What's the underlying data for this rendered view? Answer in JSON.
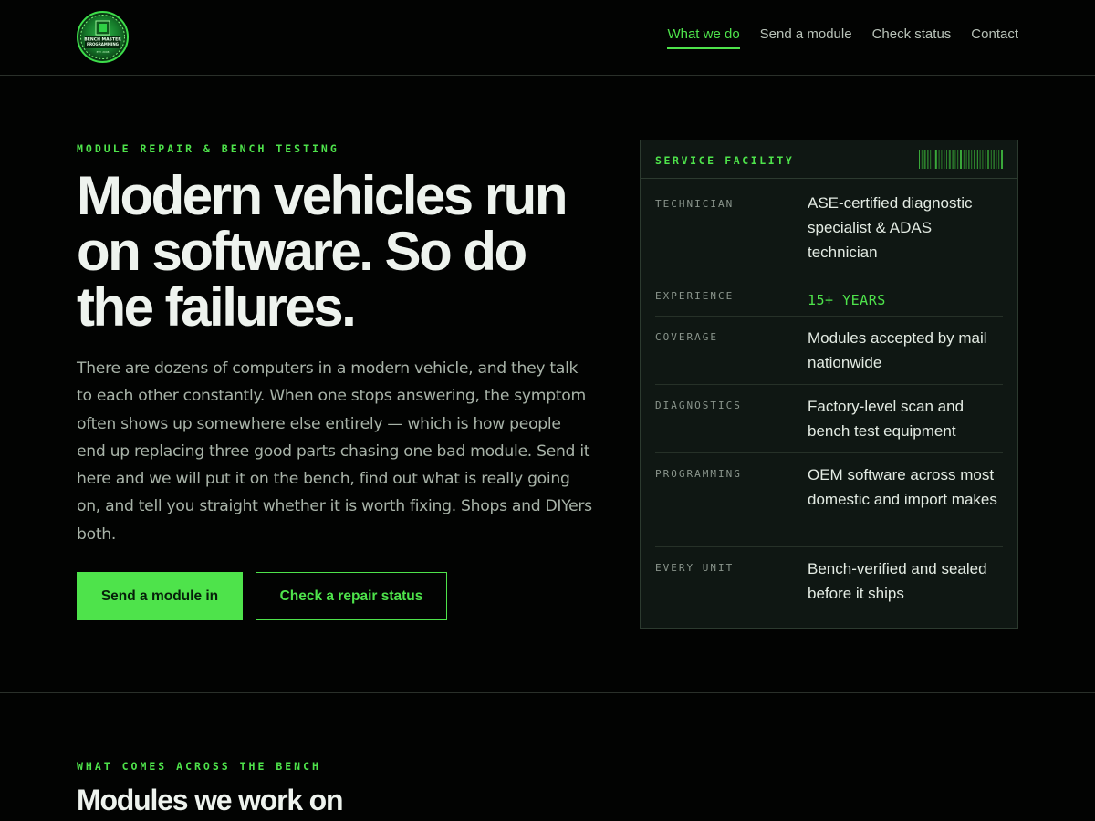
{
  "header": {
    "logo": {
      "icon": "bench-master-programming-logo",
      "text": [
        "BENCH MASTER",
        "PROGRAMMING",
        "EST. 2008"
      ]
    },
    "nav": [
      {
        "label": "What we do",
        "active": true
      },
      {
        "label": "Send a module",
        "active": false
      },
      {
        "label": "Check status",
        "active": false
      },
      {
        "label": "Contact",
        "active": false
      }
    ]
  },
  "hero": {
    "eyebrow": "MODULE REPAIR & BENCH TESTING",
    "title": "Modern vehicles run on software. So do the failures.",
    "body": "There are dozens of computers in a modern vehicle, and they talk to each other constantly. When one stops answering, the symptom often shows up somewhere else entirely — which is how people end up replacing three good parts chasing one bad module. Send it here and we will put it on the bench, find out what is really going on, and tell you straight whether it is worth fixing. Shops and DIYers both.",
    "primary_button": "Send a module in",
    "secondary_button": "Check a repair status"
  },
  "facility_card": {
    "title": "SERVICE FACILITY",
    "barcode_icon": "barcode-icon",
    "rows": [
      {
        "label": "TECHNICIAN",
        "value": "ASE-certified diagnostic specialist & ADAS technician"
      },
      {
        "label": "EXPERIENCE",
        "value": "15+ YEARS"
      },
      {
        "label": "COVERAGE",
        "value": "Modules accepted by mail nationwide"
      },
      {
        "label": "DIAGNOSTICS",
        "value": "Factory-level scan and bench test equipment"
      },
      {
        "label": "PROGRAMMING",
        "value": "OEM software across most domestic and import makes"
      },
      {
        "label": "EVERY UNIT",
        "value": "Bench-verified and sealed before it ships"
      }
    ]
  },
  "modules_section": {
    "eyebrow": "WHAT COMES ACROSS THE BENCH",
    "title": "Modules we work on"
  },
  "colors": {
    "accent": "#4ee34b",
    "background": "#020302",
    "card": "#0f1713"
  }
}
